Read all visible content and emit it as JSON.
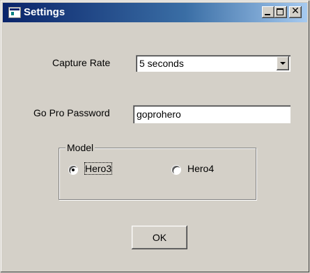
{
  "window": {
    "title": "Settings",
    "close_glyph": "✕"
  },
  "capture_rate": {
    "label": "Capture Rate",
    "selected": "5 seconds"
  },
  "password": {
    "label": "Go Pro Password",
    "value": "goprohero"
  },
  "model": {
    "legend": "Model",
    "options": [
      {
        "label": "Hero3",
        "checked": true
      },
      {
        "label": "Hero4",
        "checked": false
      }
    ]
  },
  "buttons": {
    "ok_label": "OK"
  },
  "colors": {
    "face": "#d4d0c8",
    "title_active": "#0a246a",
    "title_gradient_end": "#a6caf0"
  },
  "icons": [
    "app-icon",
    "minimize-icon",
    "maximize-icon",
    "close-icon",
    "dropdown-arrow-icon"
  ]
}
